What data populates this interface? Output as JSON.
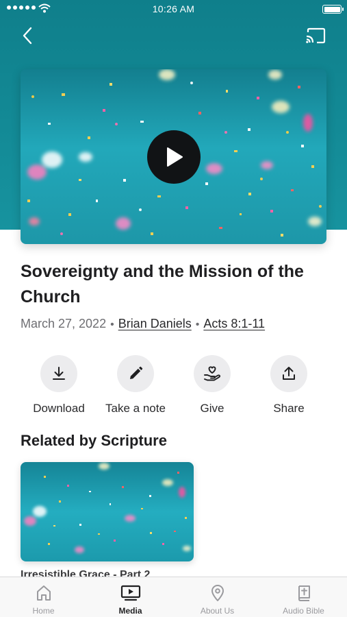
{
  "status_bar": {
    "time": "10:26 AM"
  },
  "header": {
    "back_icon": "chevron-left-icon",
    "cast_icon": "cast-icon"
  },
  "video": {
    "play_icon": "play-icon"
  },
  "sermon": {
    "title": "Sovereignty and the Mission of the Church",
    "date": "March 27, 2022",
    "separator": "•",
    "speaker": "Brian Daniels",
    "scripture": "Acts 8:1-11"
  },
  "actions": [
    {
      "label": "Download",
      "icon": "download-icon"
    },
    {
      "label": "Take a note",
      "icon": "pencil-icon"
    },
    {
      "label": "Give",
      "icon": "give-hand-heart-icon"
    },
    {
      "label": "Share",
      "icon": "share-icon"
    }
  ],
  "related": {
    "section_title": "Related by Scripture",
    "items": [
      {
        "title": "Irresistible Grace - Part 2"
      }
    ]
  },
  "tabs": [
    {
      "label": "Home",
      "icon": "home-icon",
      "active": false
    },
    {
      "label": "Media",
      "icon": "media-tv-icon",
      "active": true
    },
    {
      "label": "About Us",
      "icon": "location-pin-icon",
      "active": false
    },
    {
      "label": "Audio Bible",
      "icon": "bible-book-icon",
      "active": false
    }
  ],
  "colors": {
    "header_teal": "#0f7f8b",
    "video_teal": "#1fa6b7",
    "play_button": "#111315",
    "action_circle": "#ececee"
  }
}
